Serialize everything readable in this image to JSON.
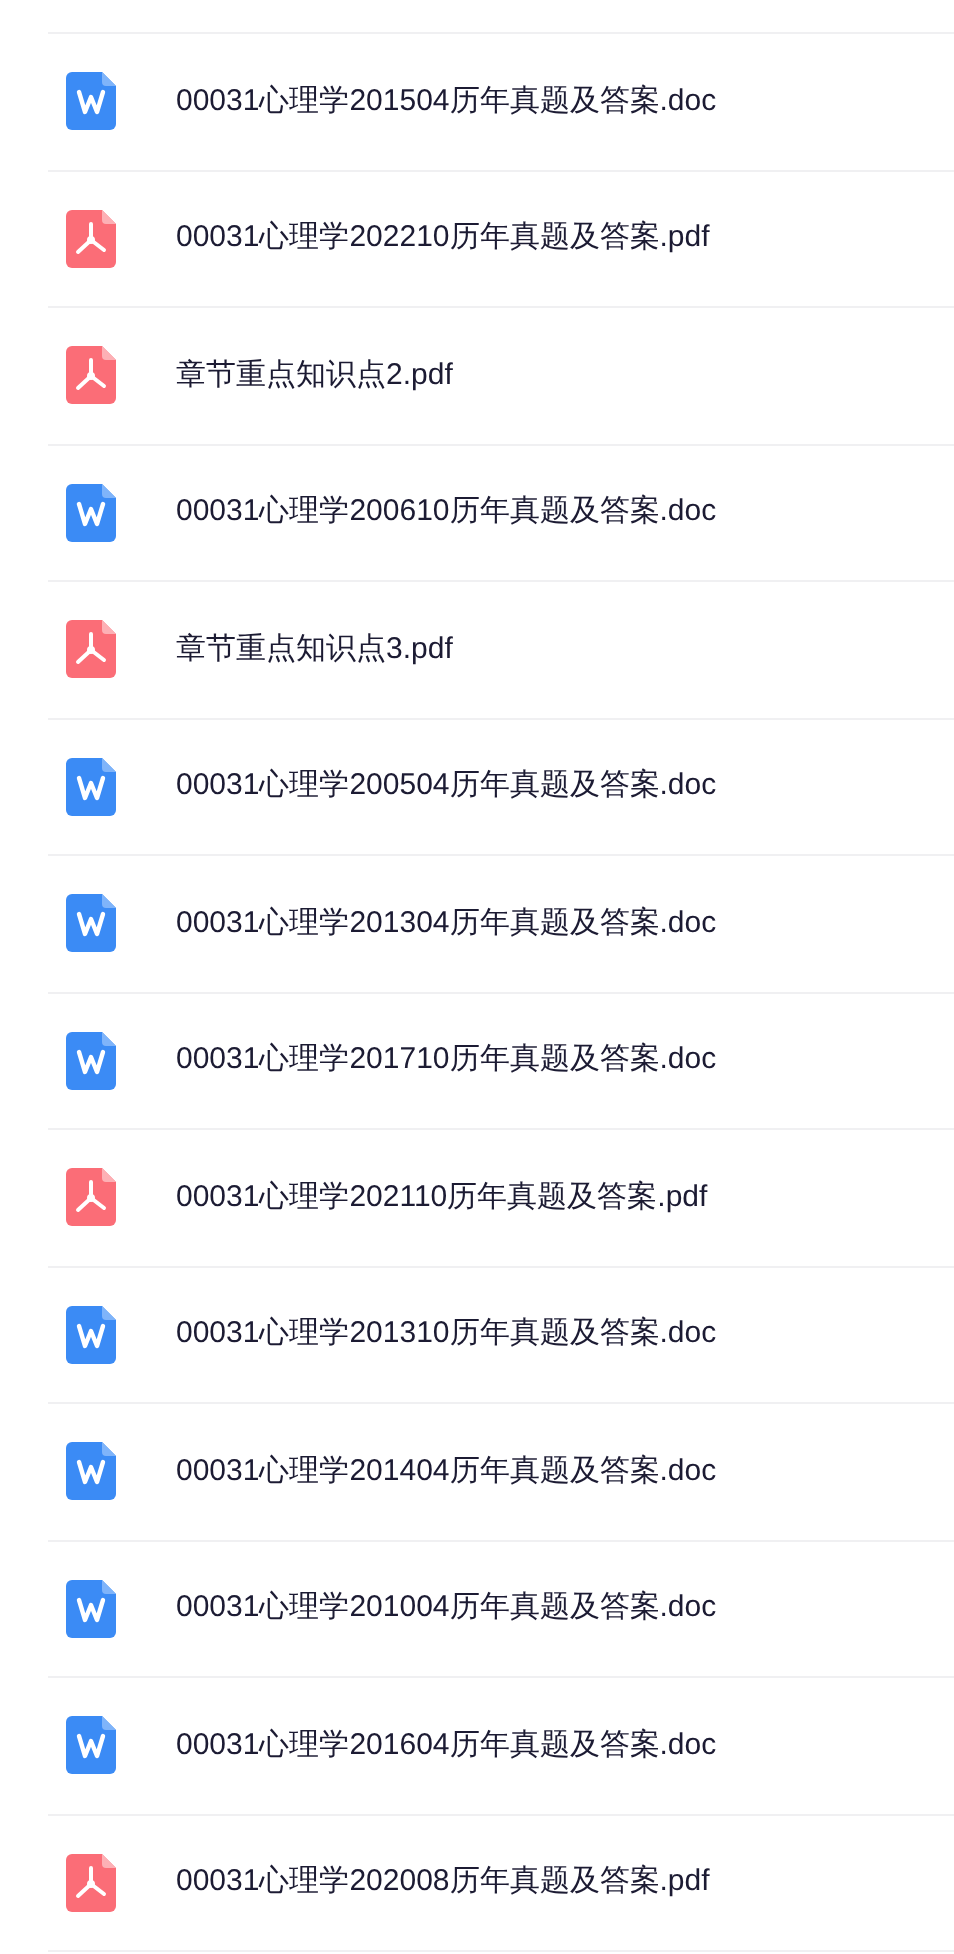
{
  "files": [
    {
      "kind": "doc",
      "name": "00031心理学201504历年真题及答案.doc"
    },
    {
      "kind": "pdf",
      "name": "00031心理学202210历年真题及答案.pdf"
    },
    {
      "kind": "pdf",
      "name": "章节重点知识点2.pdf"
    },
    {
      "kind": "doc",
      "name": "00031心理学200610历年真题及答案.doc"
    },
    {
      "kind": "pdf",
      "name": "章节重点知识点3.pdf"
    },
    {
      "kind": "doc",
      "name": "00031心理学200504历年真题及答案.doc"
    },
    {
      "kind": "doc",
      "name": "00031心理学201304历年真题及答案.doc"
    },
    {
      "kind": "doc",
      "name": "00031心理学201710历年真题及答案.doc"
    },
    {
      "kind": "pdf",
      "name": "00031心理学202110历年真题及答案.pdf"
    },
    {
      "kind": "doc",
      "name": "00031心理学201310历年真题及答案.doc"
    },
    {
      "kind": "doc",
      "name": "00031心理学201404历年真题及答案.doc"
    },
    {
      "kind": "doc",
      "name": "00031心理学201004历年真题及答案.doc"
    },
    {
      "kind": "doc",
      "name": "00031心理学201604历年真题及答案.doc"
    },
    {
      "kind": "pdf",
      "name": "00031心理学202008历年真题及答案.pdf"
    }
  ]
}
